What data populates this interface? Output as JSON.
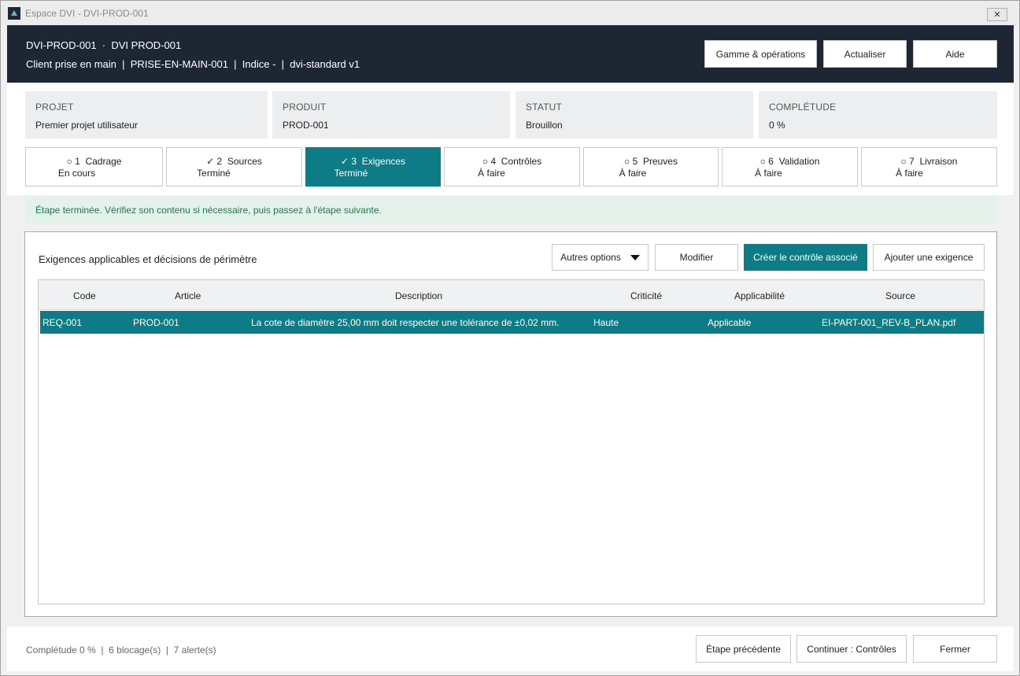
{
  "window": {
    "title": "Espace DVI - DVI-PROD-001",
    "close_glyph": "✕"
  },
  "header": {
    "title": "DVI-PROD-001  ·  DVI PROD-001",
    "subtitle": "Client prise en main  |  PRISE-EN-MAIN-001  |  Indice -  |  dvi-standard v1",
    "buttons": {
      "gamme": "Gamme & opérations",
      "refresh": "Actualiser",
      "help": "Aide"
    }
  },
  "info_cards": [
    {
      "label": "PROJET",
      "value": "Premier projet utilisateur"
    },
    {
      "label": "PRODUIT",
      "value": "PROD-001"
    },
    {
      "label": "STATUT",
      "value": "Brouillon"
    },
    {
      "label": "COMPLÉTUDE",
      "value": "0 %"
    }
  ],
  "steps": [
    {
      "marker": "○",
      "number": "1",
      "name": "Cadrage",
      "status": "En cours",
      "active": false
    },
    {
      "marker": "✓",
      "number": "2",
      "name": "Sources",
      "status": "Terminé",
      "active": false
    },
    {
      "marker": "✓",
      "number": "3",
      "name": "Exigences",
      "status": "Terminé",
      "active": true
    },
    {
      "marker": "○",
      "number": "4",
      "name": "Contrôles",
      "status": "À faire",
      "active": false
    },
    {
      "marker": "○",
      "number": "5",
      "name": "Preuves",
      "status": "À faire",
      "active": false
    },
    {
      "marker": "○",
      "number": "6",
      "name": "Validation",
      "status": "À faire",
      "active": false
    },
    {
      "marker": "○",
      "number": "7",
      "name": "Livraison",
      "status": "À faire",
      "active": false
    }
  ],
  "banner": {
    "text": "Étape terminée. Vérifiez son contenu si nécessaire, puis passez à l'étape suivante."
  },
  "panel": {
    "title": "Exigences applicables et décisions de périmètre",
    "buttons": {
      "more_options": "Autres options",
      "edit": "Modifier",
      "create_control": "Créer le contrôle associé",
      "add_requirement": "Ajouter une exigence"
    }
  },
  "table": {
    "columns": [
      "Code",
      "Article",
      "Description",
      "Criticité",
      "Applicabilité",
      "Source"
    ],
    "rows": [
      [
        "REQ-001",
        "PROD-001",
        "La cote de diamètre 25,00 mm doit respecter une tolérance de ±0,02 mm.",
        "Haute",
        "Applicable",
        "EI-PART-001_REV-B_PLAN.pdf"
      ]
    ]
  },
  "footer": {
    "status": "Complétude 0 %  |  6 blocage(s)  |  7 alerte(s)",
    "buttons": {
      "previous": "Étape précédente",
      "continue": "Continuer : Contrôles",
      "close": "Fermer"
    }
  },
  "colors": {
    "header_bg": "#1d2733",
    "accent": "#0e7c86",
    "banner_bg": "#e3f2ea",
    "banner_text": "#1e7a45"
  }
}
